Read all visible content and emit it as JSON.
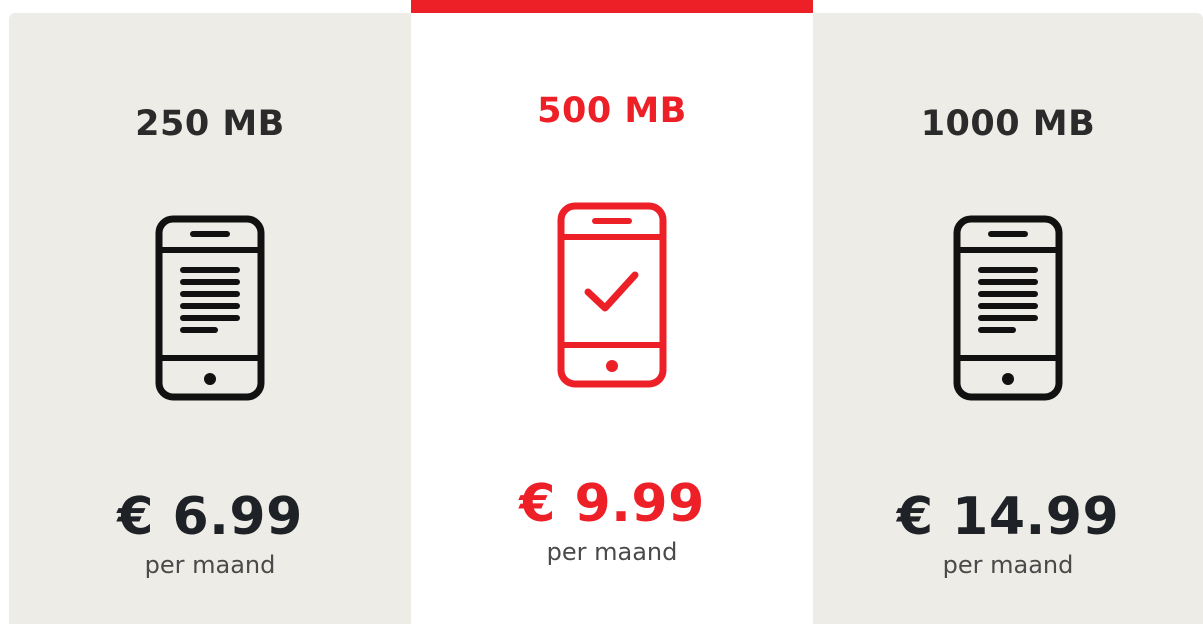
{
  "colors": {
    "accent": "#ee2027",
    "dark": "#111111",
    "card_bg": "#eeece7"
  },
  "plans": [
    {
      "name": "250 MB",
      "price": "€ 6.99",
      "period": "per maand",
      "icon": "phone-text-icon"
    },
    {
      "name": "500 MB",
      "price": "€ 9.99",
      "period": "per maand",
      "icon": "phone-check-icon"
    },
    {
      "name": "1000 MB",
      "price": "€ 14.99",
      "period": "per maand",
      "icon": "phone-text-icon"
    }
  ]
}
